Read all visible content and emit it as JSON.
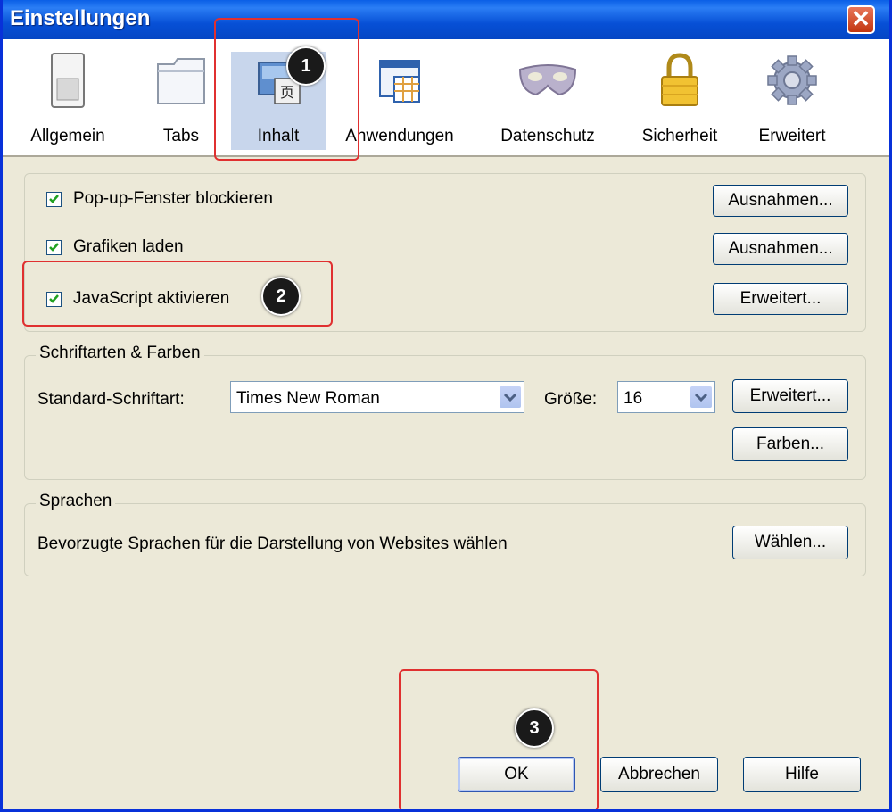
{
  "window": {
    "title": "Einstellungen",
    "close_symbol": "✕"
  },
  "tabs": [
    {
      "label": "Allgemein",
      "icon": "switch-icon",
      "active": false
    },
    {
      "label": "Tabs",
      "icon": "folder-icon",
      "active": false
    },
    {
      "label": "Inhalt",
      "icon": "content-icon",
      "active": true
    },
    {
      "label": "Anwendungen",
      "icon": "applications-icon",
      "active": false
    },
    {
      "label": "Datenschutz",
      "icon": "mask-icon",
      "active": false
    },
    {
      "label": "Sicherheit",
      "icon": "padlock-icon",
      "active": false
    },
    {
      "label": "Erweitert",
      "icon": "gear-icon",
      "active": false
    }
  ],
  "content_options": {
    "popup": {
      "label": "Pop-up-Fenster blockieren",
      "checked": true,
      "button": "Ausnahmen..."
    },
    "images": {
      "label": "Grafiken laden",
      "checked": true,
      "button": "Ausnahmen..."
    },
    "javascript": {
      "label": "JavaScript aktivieren",
      "checked": true,
      "button": "Erweitert..."
    }
  },
  "fonts": {
    "group_title": "Schriftarten & Farben",
    "default_font_label": "Standard-Schriftart:",
    "default_font_value": "Times New Roman",
    "size_label": "Größe:",
    "size_value": "16",
    "advanced_button": "Erweitert...",
    "colors_button": "Farben..."
  },
  "languages": {
    "group_title": "Sprachen",
    "description": "Bevorzugte Sprachen für die Darstellung von Websites wählen",
    "choose_button": "Wählen..."
  },
  "footer": {
    "ok": "OK",
    "cancel": "Abbrechen",
    "help": "Hilfe"
  },
  "markers": [
    "1",
    "2",
    "3"
  ],
  "colors": {
    "title_bar": "#0a5fe6",
    "dialog_bg": "#ece9d8",
    "highlight": "#e03030",
    "active_tab": "#c8d6ec"
  }
}
